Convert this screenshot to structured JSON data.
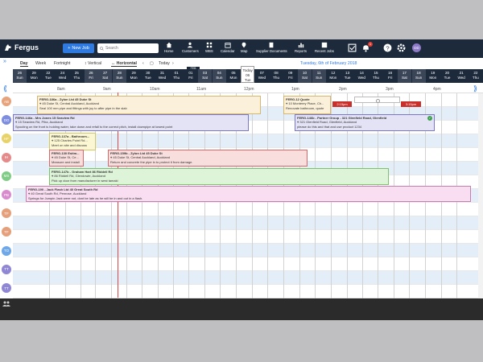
{
  "header": {
    "app_name": "Fergus",
    "new_job_label": "New Job",
    "search_placeholder": "Search",
    "nav": [
      {
        "label": "Home",
        "icon": "home-icon"
      },
      {
        "label": "Customers",
        "icon": "customers-icon"
      },
      {
        "label": "WBS",
        "icon": "wbs-icon"
      },
      {
        "label": "Calendar",
        "icon": "calendar-icon"
      },
      {
        "label": "Map",
        "icon": "map-icon"
      },
      {
        "label": "Supplier Documents",
        "icon": "documents-icon"
      },
      {
        "label": "Reports",
        "icon": "reports-icon"
      },
      {
        "label": "Recent Jobs",
        "icon": "recent-jobs-icon"
      }
    ],
    "notification_count": "1",
    "user_initials": "DD"
  },
  "toolbar": {
    "views": [
      "Day",
      "Week",
      "Fortnight"
    ],
    "vertical_label": "Vertical",
    "horizontal_label": "Horizontal",
    "today_label": "Today",
    "current_date": "Tuesday, 6th of February 2018"
  },
  "days": [
    {
      "num": "26",
      "dow": "Sun"
    },
    {
      "num": "29",
      "dow": "Mon"
    },
    {
      "num": "22",
      "dow": "Tue"
    },
    {
      "num": "24",
      "dow": "Wed"
    },
    {
      "num": "25",
      "dow": "Thu"
    },
    {
      "num": "26",
      "dow": "Fri"
    },
    {
      "num": "27",
      "dow": "Sat"
    },
    {
      "num": "28",
      "dow": "Sun"
    },
    {
      "num": "29",
      "dow": "Mon"
    },
    {
      "num": "30",
      "dow": "Tue"
    },
    {
      "num": "31",
      "dow": "Wed"
    },
    {
      "num": "01",
      "dow": "Thu"
    },
    {
      "num": "01",
      "dow": "Fri"
    },
    {
      "num": "03",
      "dow": "Sat"
    },
    {
      "num": "04",
      "dow": "Sun"
    },
    {
      "num": "05",
      "dow": "Mon"
    },
    {
      "num": "06",
      "dow": "Tue"
    },
    {
      "num": "07",
      "dow": "Wed"
    },
    {
      "num": "08",
      "dow": "Thu"
    },
    {
      "num": "09",
      "dow": "Fri"
    },
    {
      "num": "10",
      "dow": "Sat"
    },
    {
      "num": "11",
      "dow": "Sun"
    },
    {
      "num": "12",
      "dow": "Mon"
    },
    {
      "num": "13",
      "dow": "Tue"
    },
    {
      "num": "14",
      "dow": "Wed"
    },
    {
      "num": "15",
      "dow": "Thu"
    },
    {
      "num": "16",
      "dow": "Fri"
    },
    {
      "num": "17",
      "dow": "Sat"
    },
    {
      "num": "18",
      "dow": "Sun"
    },
    {
      "num": "19",
      "dow": "Mon"
    },
    {
      "num": "20",
      "dow": "Tue"
    },
    {
      "num": "21",
      "dow": "Wed"
    },
    {
      "num": "22",
      "dow": "Thu"
    }
  ],
  "today_marker": {
    "label": "Today",
    "num": "06",
    "dow": "Tue"
  },
  "feb_label": "FEB",
  "times": [
    "8am",
    "9am",
    "10am",
    "11am",
    "12pm",
    "1pm",
    "2pm",
    "3pm",
    "4pm"
  ],
  "staff": [
    {
      "initials": "AB",
      "color": "#e7a37c"
    },
    {
      "initials": "DO",
      "color": "#7d8de0"
    },
    {
      "initials": "HF",
      "color": "#e8d36a"
    },
    {
      "initials": "IH",
      "color": "#e58a8a"
    },
    {
      "initials": "MS",
      "color": "#7fcc86"
    },
    {
      "initials": "PB",
      "color": "#d88ccd"
    },
    {
      "initials": "TF",
      "color": "#e5a07b"
    },
    {
      "initials": "TF",
      "color": "#e5a07b"
    },
    {
      "initials": "TO",
      "color": "#6ea8e8"
    },
    {
      "initials": "TT",
      "color": "#8f87d4"
    },
    {
      "initials": "TT",
      "color": "#8f87d4"
    }
  ],
  "jobs": [
    {
      "id": "j1",
      "title": "FERG-186a - Zylon Ltd 45 Duke St",
      "address": "45 Duke St, Central Auckland, Auckland",
      "desc": "Seal 100 mm pipe and fittings with joy to after pipe in the slab"
    },
    {
      "id": "j2",
      "title": "FERG-12 Quote",
      "address": "10 Monterey Place, Ch...",
      "desc": "Renovate bathroom, quote"
    },
    {
      "id": "j3",
      "title": "FERG-146a - Mrs Jones 15 Seaview Rd",
      "address": "15 Seaview Rd, Piha, Auckland",
      "desc": "Spouting on the front is holding water, take down and refall to the correct pitch, install downpipe at lowest point"
    },
    {
      "id": "j4",
      "title": "FERG-146b - Partner Group - 321 Glenfield Road, Glenfield",
      "address": "321 Glenfield Road, Glenfield, Auckland",
      "desc": "please do this and that and use product 1234"
    },
    {
      "id": "j5",
      "title": "FERG-137a - Bathroom...",
      "address": "125 Charles Point Rd...",
      "desc": "Meet on site and discuss"
    },
    {
      "id": "j6",
      "title": "FERG-130 Estim...",
      "address": "45 Duke St, Ce...",
      "desc": "Measure and install"
    },
    {
      "id": "j7",
      "title": "FERG-159b - Zylon Ltd 45 Duke St",
      "address": "45 Duke St, Central Auckland, Auckland",
      "desc": "Return and concrete the pipe in to protect it from damage."
    },
    {
      "id": "j8",
      "title": "FERG-147b - Graham Hart 86 Riddell Rd",
      "address": "86 Riddell Rd, Glendowie, Auckland",
      "desc": "Pick up door from manufacturer in west tamaki"
    },
    {
      "id": "j9",
      "title": "FERG-190 - Jack Flash Ltd 40 Great South Rd",
      "address": "40 Great South Rd, Penrose, Auckland",
      "desc": "Springs for Jumpin Jack were not, dont be late as he will be in and out in a flash."
    }
  ],
  "time_tags": [
    "2:15pm",
    "3:15pm"
  ]
}
